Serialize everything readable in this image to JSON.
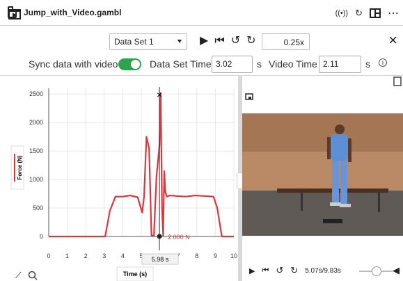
{
  "window": {
    "title": "Jump_with_Video.gambl"
  },
  "toolbar": {
    "data_set": "Data Set 1",
    "speed": "0.25x"
  },
  "sync": {
    "label": "Sync data with video",
    "toggle_on": true,
    "data_set_time_label": "Data Set Time",
    "data_set_time": "3.02",
    "data_set_time_unit": "s",
    "video_time_label": "Video Time",
    "video_time": "2.11",
    "video_time_unit": "s"
  },
  "graph": {
    "cursor_label": "5.98 s",
    "point_label": "2.000 N",
    "icons": [
      "graph-icon",
      "zoom-icon"
    ]
  },
  "chart_data": {
    "type": "line",
    "xlabel": "Time (s)",
    "ylabel": "Force (N)",
    "xlim": [
      0,
      10
    ],
    "ylim": [
      0,
      2600
    ],
    "x_ticks": [
      0,
      1,
      2,
      3,
      4,
      5,
      6,
      7,
      8,
      9,
      10
    ],
    "y_ticks": [
      0,
      500,
      1000,
      1500,
      2000,
      2500
    ],
    "grid": true,
    "series": [
      {
        "name": "",
        "color": "#d9363e",
        "x": [
          0,
          2.8,
          3.05,
          3.3,
          3.6,
          4.0,
          4.4,
          4.8,
          5.05,
          5.15,
          5.28,
          5.42,
          5.55,
          5.68,
          5.82,
          5.98,
          6.05,
          6.12,
          6.18,
          6.24,
          6.3,
          6.38,
          6.55,
          6.9,
          7.4,
          7.9,
          8.4,
          8.9,
          9.1,
          9.35,
          10
        ],
        "y": [
          0,
          0,
          0,
          450,
          700,
          700,
          720,
          690,
          420,
          700,
          1750,
          1550,
          20,
          10,
          1050,
          1600,
          2520,
          500,
          10,
          1150,
          780,
          700,
          720,
          710,
          700,
          720,
          710,
          700,
          500,
          0,
          0
        ]
      }
    ],
    "cursor_x": 5.98,
    "point": {
      "x": 5.98,
      "y": 2,
      "label": "2.000 N"
    }
  },
  "video": {
    "time_readout": "5.07s/9.83s",
    "progress": 0.516
  }
}
